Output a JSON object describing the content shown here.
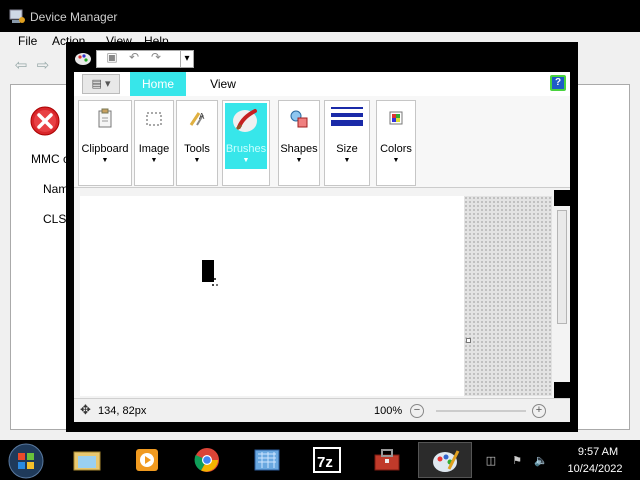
{
  "device_manager": {
    "title": "Device Manager",
    "menu": [
      "File",
      "Action",
      "View",
      "Help"
    ],
    "content_labels": [
      "MMC c",
      "Nam",
      "CLSI"
    ]
  },
  "paint": {
    "tabs": {
      "home": "Home",
      "view": "View"
    },
    "groups": {
      "clipboard": "Clipboard",
      "image": "Image",
      "tools": "Tools",
      "brushes": "Brushes",
      "shapes": "Shapes",
      "size": "Size",
      "colors": "Colors"
    },
    "status": {
      "cursor_position": "134, 82px",
      "zoom": "100%"
    }
  },
  "taskbar": {
    "time": "9:57 AM",
    "date": "10/24/2022",
    "pinned": [
      "explorer",
      "media-player",
      "chrome",
      "network-tool",
      "7zip",
      "toolbox",
      "paint"
    ]
  },
  "colors": {
    "accent_cyan": "#37e6ea",
    "help_green": "#49d33e"
  }
}
